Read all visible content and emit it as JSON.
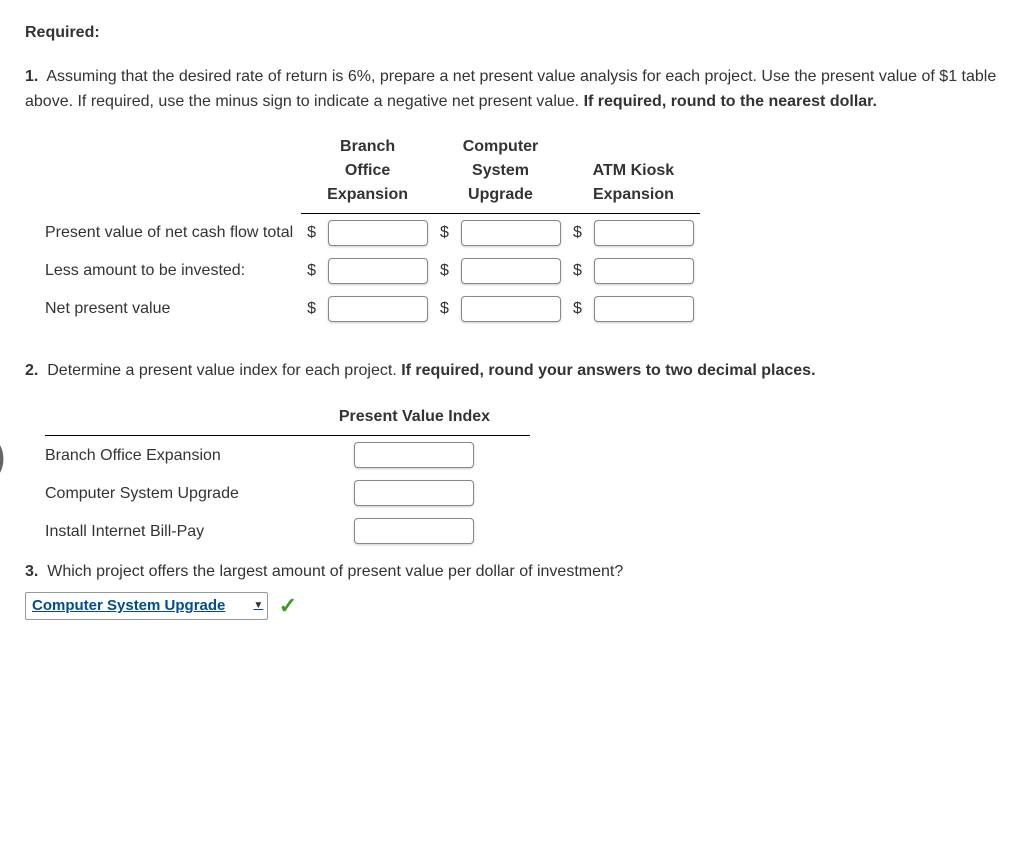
{
  "required_label": "Required:",
  "q1": {
    "num": "1.",
    "text_before_bold": "Assuming that the desired rate of return is 6%, prepare a net present value analysis for each project. Use the present value of $1 table above. If required, use the minus sign to indicate a negative net present value. ",
    "bold_text": "If required, round to the nearest dollar."
  },
  "table1": {
    "headers": {
      "col1_line1": "Branch",
      "col1_line2": "Office",
      "col1_line3": "Expansion",
      "col2_line1": "Computer",
      "col2_line2": "System",
      "col2_line3": "Upgrade",
      "col3_line1": "ATM Kiosk",
      "col3_line2": "Expansion"
    },
    "rows": {
      "r1": "Present value of net cash flow total",
      "r2": "Less amount to be invested:",
      "r3": "Net present value"
    },
    "currency": "$"
  },
  "q2": {
    "num": "2.",
    "text_before_bold": "Determine a present value index for each project. ",
    "bold_text": "If required, round your answers to two decimal places."
  },
  "table2": {
    "header": "Present Value Index",
    "rows": {
      "r1": "Branch Office Expansion",
      "r2": "Computer System Upgrade",
      "r3": "Install Internet Bill-Pay"
    }
  },
  "q3": {
    "num": "3.",
    "text": "Which project offers the largest amount of present value per dollar of investment?"
  },
  "answer_select": "Computer System Upgrade"
}
